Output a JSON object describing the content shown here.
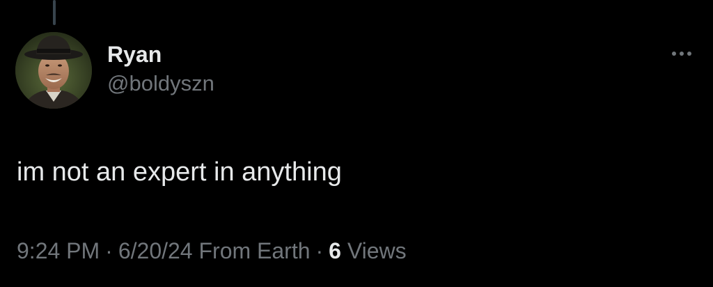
{
  "tweet": {
    "author": {
      "display_name": "Ryan",
      "handle": "@boldyszn"
    },
    "text": "im not an expert in anything",
    "meta": {
      "time": "9:24 PM",
      "separator": "·",
      "date": "6/20/24",
      "source": "From Earth",
      "views_count": "6",
      "views_label": "Views"
    },
    "icons": {
      "more": "more-horizontal-icon",
      "avatar": "profile-avatar"
    }
  },
  "colors": {
    "background": "#000000",
    "primary_text": "#e7e9ea",
    "secondary_text": "#71767b",
    "thread_line": "#38444d"
  }
}
